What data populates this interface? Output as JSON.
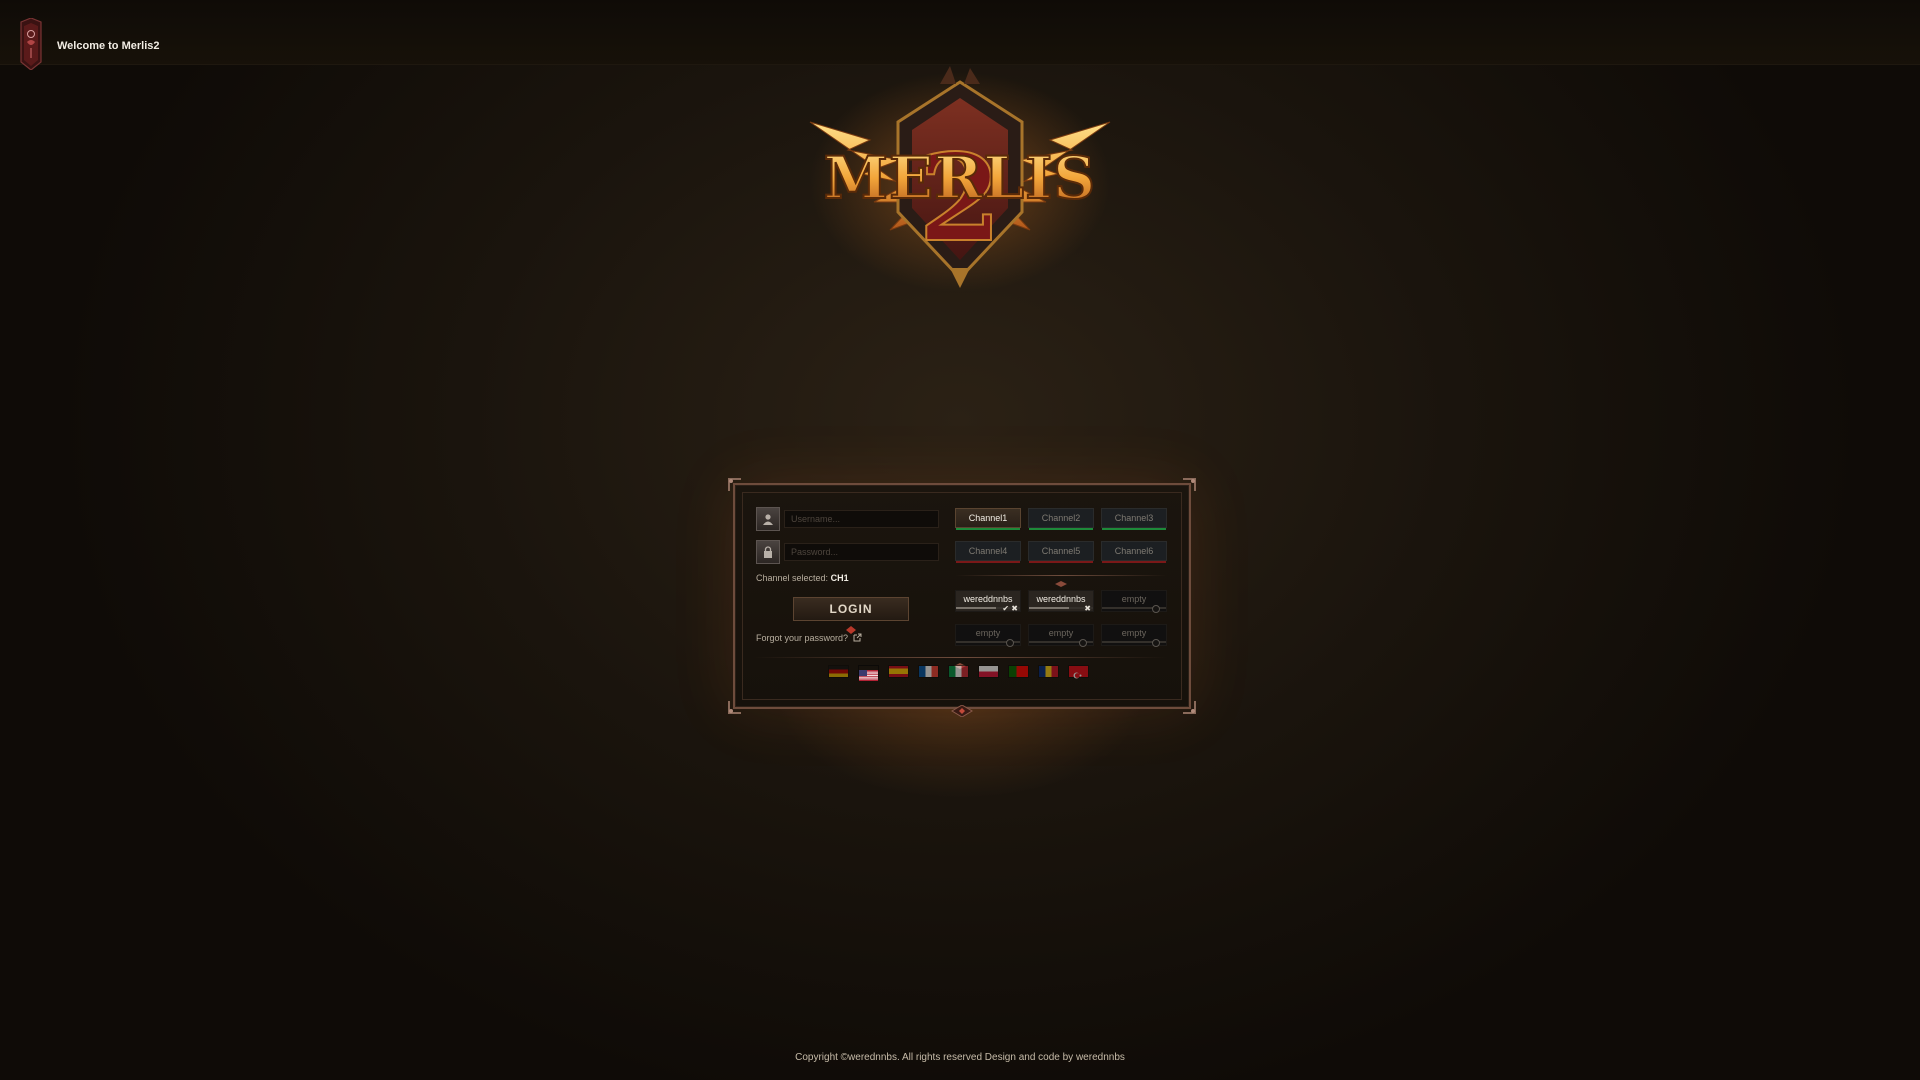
{
  "app": {
    "title": "Welcome to Merlis2"
  },
  "logo": {
    "text": "MERLIS",
    "numeral": "2"
  },
  "login": {
    "username_placeholder": "Username...",
    "password_placeholder": "Password...",
    "channel_selected_label": "Channel selected:",
    "channel_selected_value": "CH1",
    "login_label": "LOGIN",
    "forgot_label": "Forgot your password?"
  },
  "channels": [
    {
      "label": "Channel1",
      "status": "online",
      "active": true
    },
    {
      "label": "Channel2",
      "status": "online",
      "active": false
    },
    {
      "label": "Channel3",
      "status": "online",
      "active": false
    },
    {
      "label": "Channel4",
      "status": "offline",
      "active": false
    },
    {
      "label": "Channel5",
      "status": "offline",
      "active": false
    },
    {
      "label": "Channel6",
      "status": "offline",
      "active": false
    }
  ],
  "saved_accounts": [
    {
      "label": "wereddnnbs",
      "filled": true
    },
    {
      "label": "wereddnnbs",
      "filled": true
    },
    {
      "label": "empty",
      "filled": false
    },
    {
      "label": "empty",
      "filled": false
    },
    {
      "label": "empty",
      "filled": false
    },
    {
      "label": "empty",
      "filled": false
    }
  ],
  "languages": [
    {
      "code": "de",
      "name": "german-flag"
    },
    {
      "code": "en",
      "name": "usa-flag",
      "active": true
    },
    {
      "code": "es",
      "name": "spain-flag"
    },
    {
      "code": "fr",
      "name": "france-flag"
    },
    {
      "code": "it",
      "name": "italy-flag"
    },
    {
      "code": "pl",
      "name": "poland-flag"
    },
    {
      "code": "pt",
      "name": "portugal-flag"
    },
    {
      "code": "ro",
      "name": "romania-flag"
    },
    {
      "code": "tr",
      "name": "turkey-flag"
    }
  ],
  "footer": {
    "text": "Copyright ©werednnbs. All rights reserved Design and code by werednnbs"
  },
  "colors": {
    "background": "#1a140d",
    "panel_border": "#6e4c3c",
    "channel_online": "#1d8a3a",
    "channel_offline": "#7a1818",
    "logo_gold": "#f2b54a",
    "logo_red": "#8a1c1c"
  }
}
